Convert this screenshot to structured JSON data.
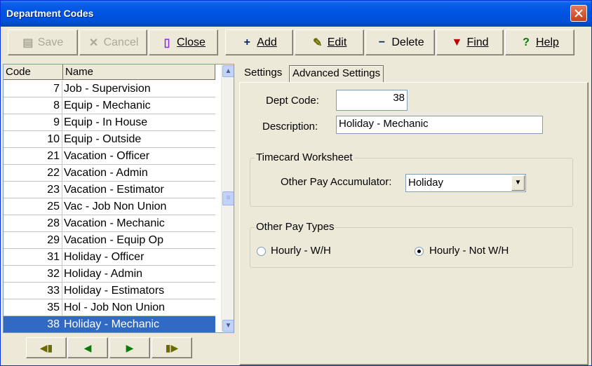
{
  "window": {
    "title": "Department Codes"
  },
  "toolbar": {
    "save_label": "Save",
    "cancel_label": "Cancel",
    "close_label": "Close",
    "add_label": "Add",
    "edit_label": "Edit",
    "delete_label": "Delete",
    "find_label": "Find",
    "help_label": "Help"
  },
  "list": {
    "headers": {
      "code": "Code",
      "name": "Name"
    },
    "rows": [
      {
        "code": "7",
        "name": "Job - Supervision"
      },
      {
        "code": "8",
        "name": "Equip - Mechanic"
      },
      {
        "code": "9",
        "name": "Equip - In House"
      },
      {
        "code": "10",
        "name": "Equip - Outside"
      },
      {
        "code": "21",
        "name": "Vacation - Officer"
      },
      {
        "code": "22",
        "name": "Vacation - Admin"
      },
      {
        "code": "23",
        "name": "Vacation - Estimator"
      },
      {
        "code": "25",
        "name": "Vac - Job Non Union"
      },
      {
        "code": "28",
        "name": "Vacation - Mechanic"
      },
      {
        "code": "29",
        "name": "Vacation - Equip Op"
      },
      {
        "code": "31",
        "name": "Holiday - Officer"
      },
      {
        "code": "32",
        "name": "Holiday - Admin"
      },
      {
        "code": "33",
        "name": "Holiday - Estimators"
      },
      {
        "code": "35",
        "name": "Hol - Job Non Union"
      },
      {
        "code": "38",
        "name": "Holiday - Mechanic"
      }
    ],
    "selected_code": "38"
  },
  "tabs": [
    {
      "label": "Settings"
    },
    {
      "label": "Advanced Settings"
    }
  ],
  "form": {
    "dept_code_label": "Dept Code:",
    "dept_code_value": "38",
    "description_label": "Description:",
    "description_value": "Holiday - Mechanic",
    "timecard_group_label": "Timecard Worksheet",
    "accumulator_label": "Other Pay Accumulator:",
    "accumulator_value": "Holiday",
    "other_pay_group_label": "Other Pay  Types",
    "radio_hourly_wh_label": "Hourly - W/H",
    "radio_hourly_not_wh_label": "Hourly - Not W/H",
    "selected_pay_type": "Hourly - Not W/H"
  },
  "colors": {
    "selection": "#316ac5",
    "title_bar": "#0054e3"
  },
  "icons": {
    "save": "floppy-disk-icon",
    "cancel": "x-icon",
    "close": "door-icon",
    "add": "plus-icon",
    "edit": "notepad-pencil-icon",
    "delete": "minus-icon",
    "find": "flashlight-icon",
    "help": "question-mark-icon"
  }
}
